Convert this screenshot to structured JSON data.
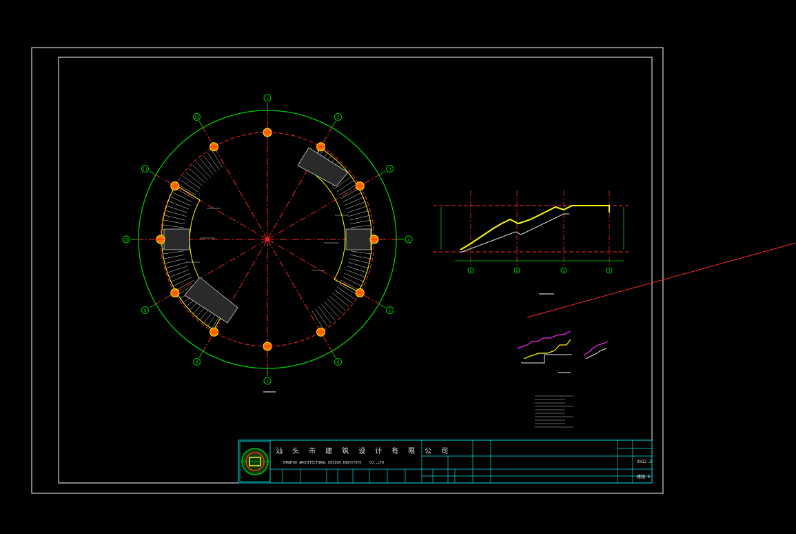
{
  "drawing": {
    "background": "#000000",
    "plan_grid_ids": [
      "1",
      "2",
      "3",
      "4",
      "5",
      "6",
      "7",
      "8",
      "9",
      "10",
      "11",
      "12"
    ],
    "profile_axis_ids": [
      "1",
      "2",
      "3",
      "4"
    ],
    "title_block": {
      "company_cn": "汕 头 市 建 筑 设 计 有 限 公 司",
      "company_en": "SHANTOU  ARCHITECTURAL  DESIGN  INSTITUTE",
      "company_suffix": "CO.,LTD",
      "date_value": "2012.3",
      "sheet_value": "建施-5"
    }
  },
  "colors": {
    "frame": "#ffffff",
    "outer_circle": "#00cc00",
    "inner_circle": "#ff2a2a",
    "axis": "#ff2a2a",
    "column": "#ff6a00",
    "stair": "#e8e8e8",
    "stair_edge": "#ffff00",
    "title_block": "#00e5e5",
    "accent_magenta": "#ff2aff"
  }
}
